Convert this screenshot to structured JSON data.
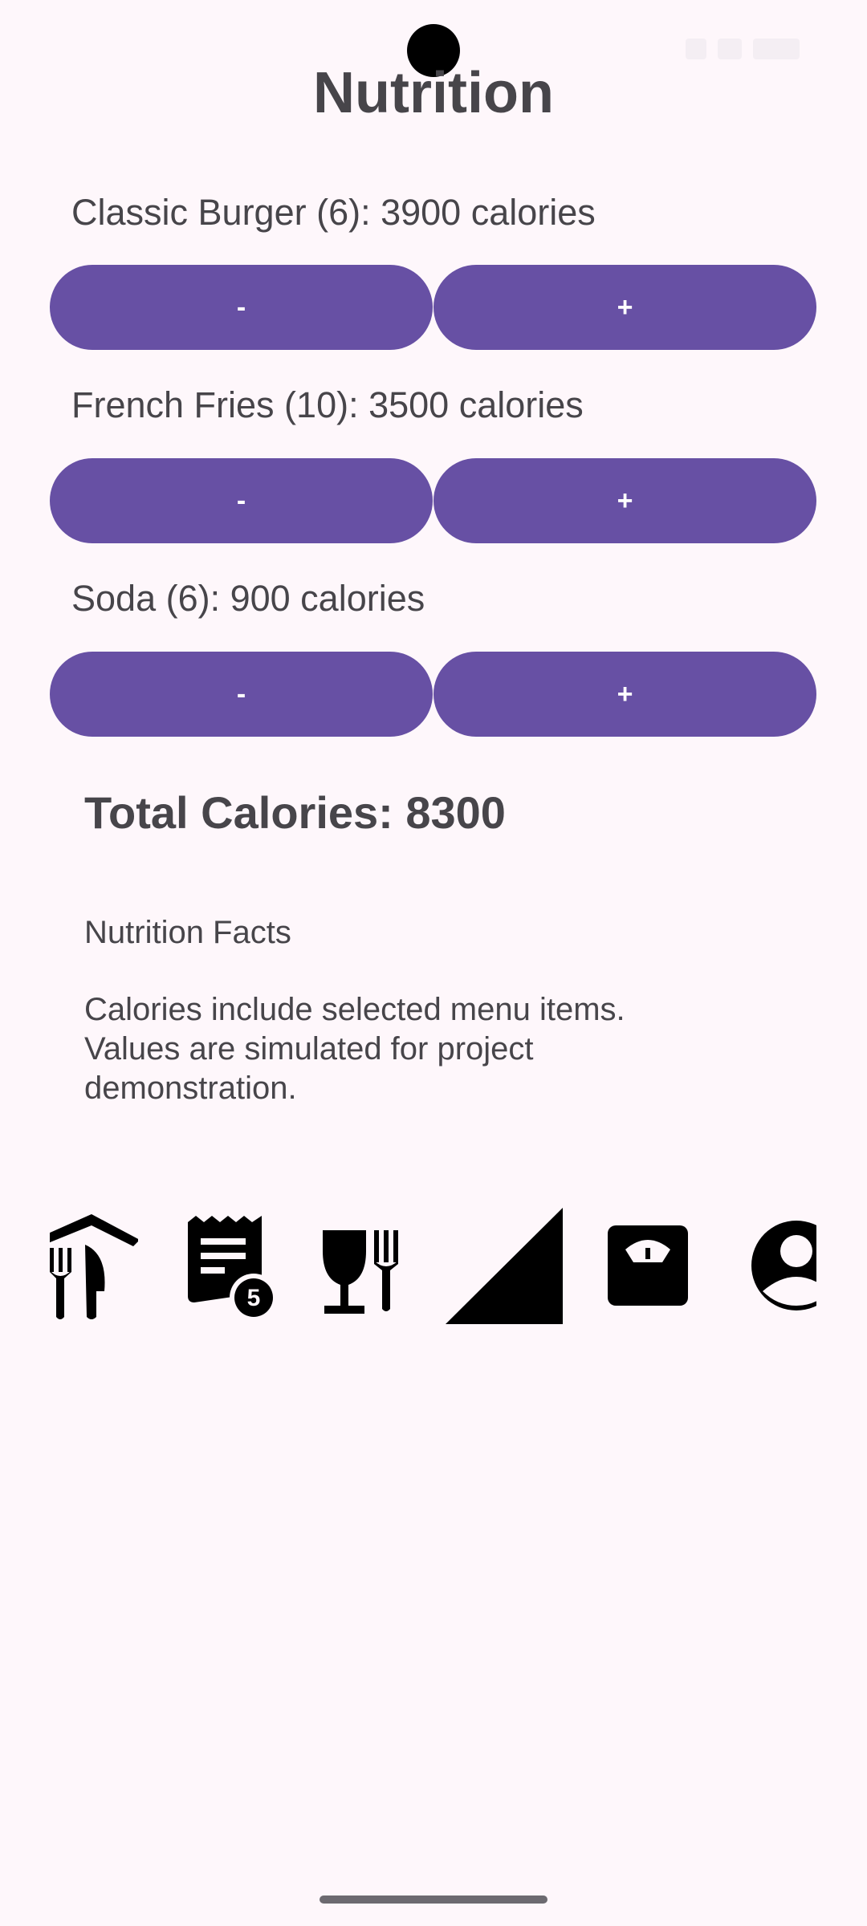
{
  "page": {
    "title": "Nutrition"
  },
  "items": [
    {
      "label": "Classic Burger (6): 3900 calories",
      "decrement_label": "-",
      "increment_label": "+"
    },
    {
      "label": "French Fries (10): 3500 calories",
      "decrement_label": "-",
      "increment_label": "+"
    },
    {
      "label": "Soda (6): 900 calories",
      "decrement_label": "-",
      "increment_label": "+"
    }
  ],
  "total": {
    "label": "Total Calories: 8300"
  },
  "facts": {
    "title": "Nutrition Facts",
    "body": "Calories include selected menu items.\nValues are simulated for project\ndemonstration."
  },
  "bottom_nav": {
    "items": [
      {
        "icon": "restaurant-icon"
      },
      {
        "icon": "receipt-badge-icon",
        "badge": "5"
      },
      {
        "icon": "wine-fork-icon"
      },
      {
        "icon": "signal-icon"
      },
      {
        "icon": "scale-icon"
      },
      {
        "icon": "account-icon"
      }
    ]
  },
  "colors": {
    "background": "#fef7fb",
    "primary": "#6750a4",
    "on_primary": "#ffffff",
    "text": "#47454a",
    "icon": "#000000"
  }
}
